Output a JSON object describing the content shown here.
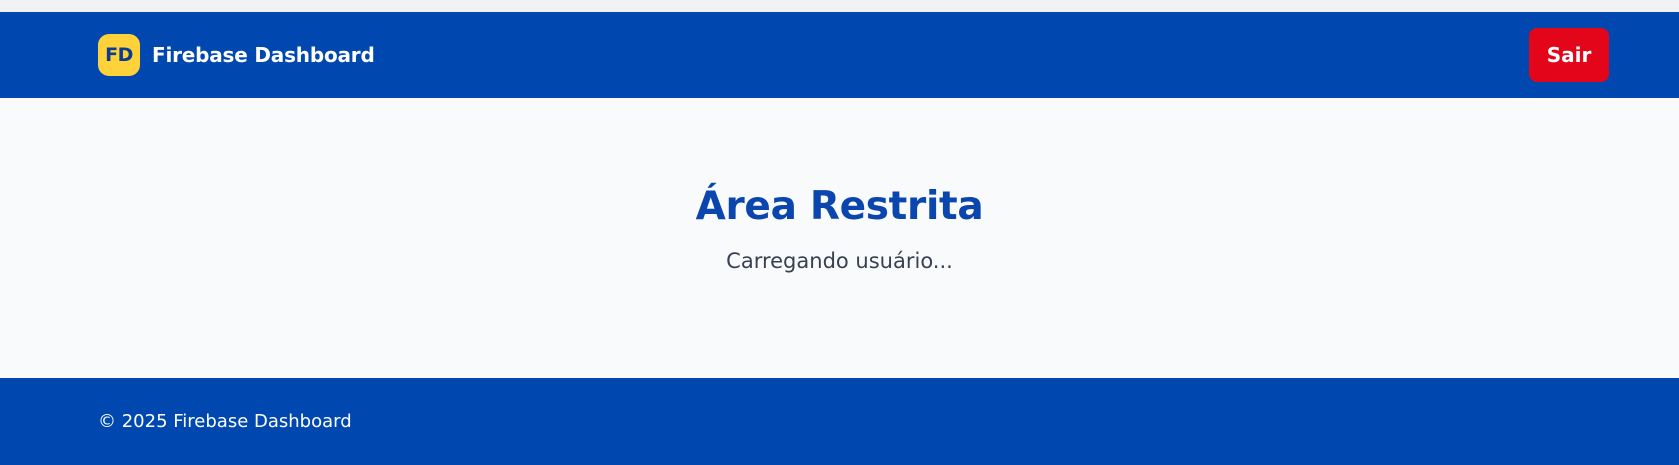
{
  "header": {
    "logo_text": "FD",
    "app_title": "Firebase Dashboard",
    "logout_label": "Sair"
  },
  "main": {
    "title": "Área Restrita",
    "status_text": "Carregando usuário..."
  },
  "footer": {
    "copyright": "© 2025 Firebase Dashboard"
  },
  "colors": {
    "primary": "#0048b0",
    "logo_bg": "#ffd23a",
    "danger": "#e3061a",
    "background": "#f9fafc"
  }
}
